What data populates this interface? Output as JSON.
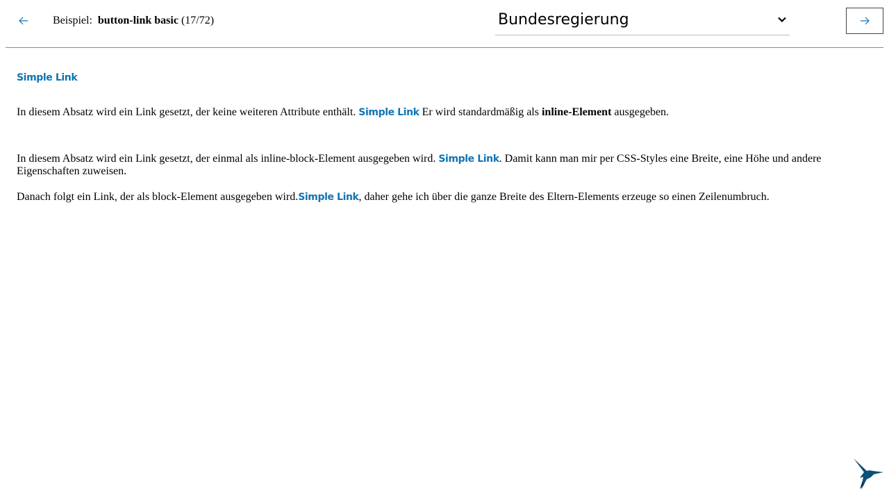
{
  "header": {
    "prev_icon": "arrow-left-icon",
    "next_icon": "arrow-right-icon",
    "example_prefix": "Beispiel:",
    "example_name": "button-link basic",
    "example_count": "(17/72)",
    "theme_select": {
      "value": "Bundesregierung",
      "icon": "chevron-down-icon"
    },
    "accent_color": "#0f74b3"
  },
  "main": {
    "block_link_label": "Simple Link",
    "paragraph1": {
      "text_before": "In diesem Absatz wird ein Link gesetzt, der keine weiteren Attribute enthält.",
      "link_label": "Simple Link",
      "text_middle": "Er wird standardmäßig als",
      "bold": "inline-Element",
      "text_after": "ausgegeben."
    },
    "paragraph2": {
      "text_before": "In diesem Absatz wird ein Link gesetzt, der einmal als inline-block-Element ausgegeben wird.",
      "link_label": "Simple Link",
      "text_after": ". Damit kann man mir per CSS-Styles eine Breite, eine Höhe und andere Eigenschaften zuweisen."
    },
    "paragraph3": {
      "text_before": "Danach folgt ein Link, der als block-Element ausgegeben wird.",
      "link_label": "Simple Link",
      "text_after": ", daher gehe ich über die ganze Breite des Eltern-Elements erzeuge so einen Zeilenumbruch."
    }
  },
  "footer": {
    "logo_icon": "hummingbird-logo-icon",
    "logo_color": "#0b4f7a"
  }
}
